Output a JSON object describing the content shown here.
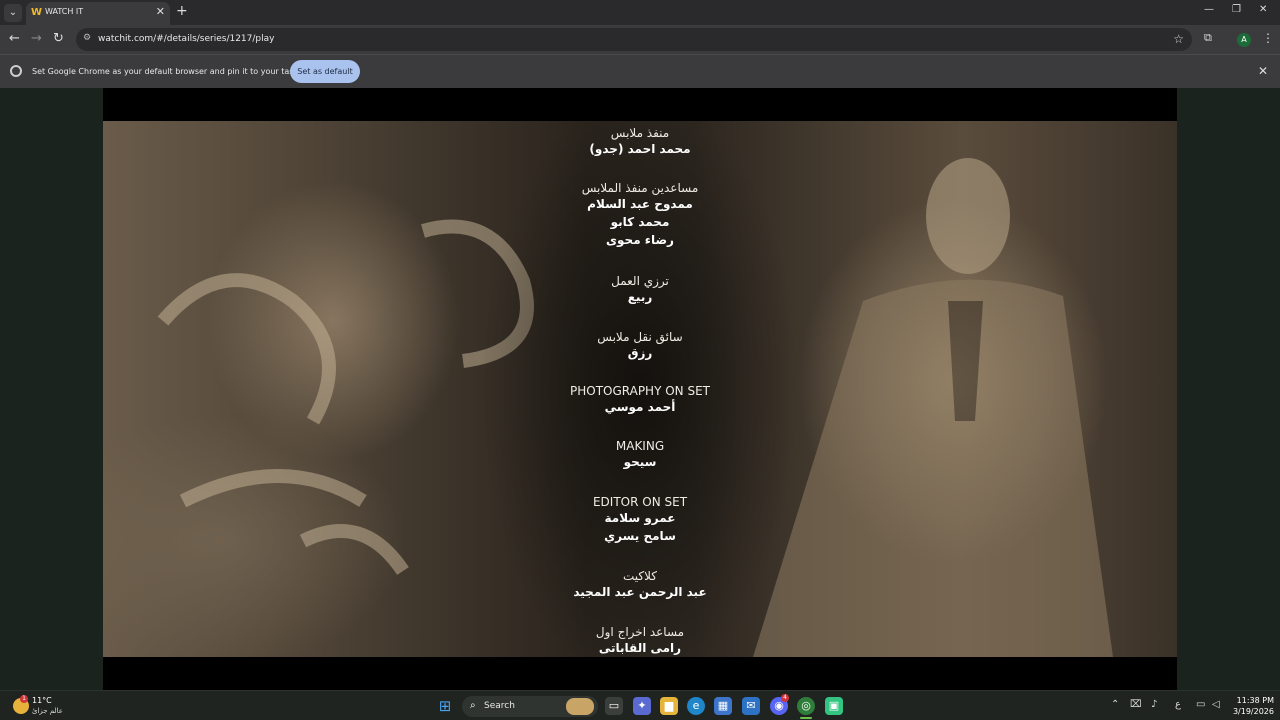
{
  "browser": {
    "tab_title": "WATCH IT",
    "tab_favicon": "W",
    "url": "watchit.com/#/details/series/1217/play",
    "profile_initial": "A"
  },
  "infobar": {
    "message": "Set Google Chrome as your default browser and pin it to your taskbar",
    "button_label": "Set as default"
  },
  "credits": [
    {
      "role": "منفذ ملابس",
      "names": [
        "محمد احمد (جدو)"
      ]
    },
    {
      "role": "مساعدين منفذ الملابس",
      "names": [
        "ممدوح عبد السلام",
        "محمد كابو",
        "رضاء محوى"
      ]
    },
    {
      "role": "ترزي العمل",
      "names": [
        "ربيع"
      ]
    },
    {
      "role": "سائق نقل ملابس",
      "names": [
        "رزق"
      ]
    },
    {
      "role": "PHOTOGRAPHY ON SET",
      "names": [
        "أحمد موسي"
      ]
    },
    {
      "role": "MAKING",
      "names": [
        "سيحو"
      ]
    },
    {
      "role": "EDITOR ON SET",
      "names": [
        "عمرو سلامة",
        "سامح يسري"
      ]
    },
    {
      "role": "كلاكيت",
      "names": [
        "عبد الرحمن عبد المجيد"
      ]
    },
    {
      "role": "مساعد اخراج اول",
      "names": [
        "رامى القاباتى"
      ]
    }
  ],
  "taskbar": {
    "weather_temp": "11°C",
    "weather_location": "عالم جزائ",
    "weather_badge": "1",
    "search_label": "Search",
    "input_indicator": "ع",
    "time": "11:38 PM",
    "date": "3/19/2026",
    "discord_badge": "4"
  },
  "icons": {
    "tab_list": "chevron-down-icon",
    "tab_close": "close-icon",
    "new_tab": "plus-icon",
    "minimize": "minimize-icon",
    "maximize": "restore-icon",
    "window_close": "close-icon",
    "back": "back-arrow-icon",
    "forward": "forward-arrow-icon",
    "reload": "reload-icon",
    "site_info": "tune-icon",
    "bookmark": "star-icon",
    "extensions": "puzzle-icon",
    "menu": "kebab-icon"
  }
}
